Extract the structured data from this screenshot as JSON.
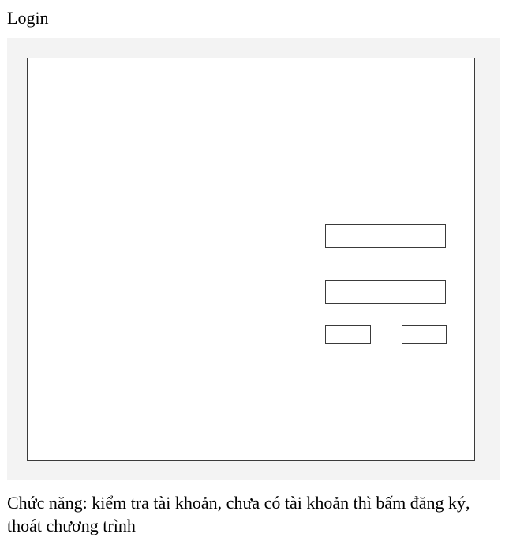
{
  "heading": "Login",
  "caption": "Chức năng: kiểm tra tài khoản, chưa có tài khoản thì bấm đăng ký, thoát chương trình",
  "wireframe": {
    "left_panel": "",
    "right_panel": {
      "fields": [
        "",
        ""
      ],
      "buttons": [
        "",
        ""
      ]
    }
  }
}
